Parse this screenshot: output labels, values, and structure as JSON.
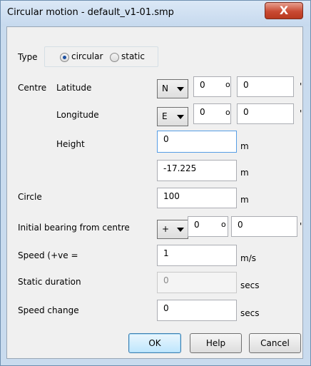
{
  "window": {
    "title": "Circular motion - default_v1-01.smp",
    "close_glyph": "X"
  },
  "type": {
    "label": "Type",
    "options": [
      "circular",
      "static"
    ],
    "selected": "circular"
  },
  "centre": {
    "label": "Centre",
    "latitude": {
      "label": "Latitude",
      "hemisphere": "N",
      "degrees": "0",
      "minutes": "0"
    },
    "longitude": {
      "label": "Longitude",
      "hemisphere": "E",
      "degrees": "0",
      "minutes": "0"
    },
    "height": {
      "label": "Height",
      "value": "0",
      "unit": "m"
    },
    "extra": {
      "value": "-17.225",
      "unit": "m"
    }
  },
  "circle": {
    "label": "Circle",
    "value": "100",
    "unit": "m"
  },
  "bearing": {
    "label": "Initial bearing from centre",
    "sign": "+",
    "degrees": "0",
    "minutes": "0"
  },
  "speed": {
    "label": "Speed (+ve =",
    "value": "1",
    "unit": "m/s"
  },
  "static_duration": {
    "label": "Static duration",
    "value": "0",
    "unit": "secs"
  },
  "speed_change": {
    "label": "Speed change",
    "value": "0",
    "unit": "secs"
  },
  "symbols": {
    "degree": "o",
    "minute": "'"
  },
  "buttons": {
    "ok": "OK",
    "help": "Help",
    "cancel": "Cancel"
  }
}
